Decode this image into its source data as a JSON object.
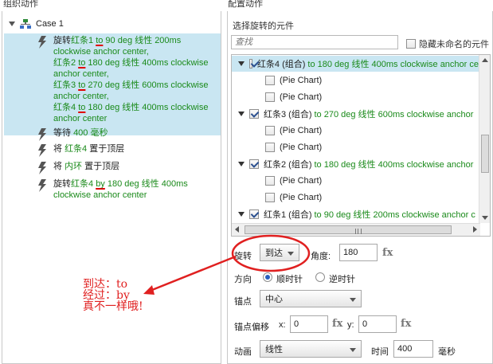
{
  "headers": {
    "left": "组织动作",
    "right": "配置动作"
  },
  "case": {
    "label": "Case 1"
  },
  "actions": [
    {
      "lines": [
        [
          {
            "t": "旋转",
            "c": "k"
          },
          {
            "t": "红条1",
            "c": "g"
          },
          {
            "t": " ",
            "c": "g"
          },
          {
            "t": "to",
            "c": "g",
            "u": true
          },
          {
            "t": " 90 deg 线性 200ms",
            "c": "g"
          }
        ],
        [
          {
            "t": "clockwise anchor center,",
            "c": "g"
          }
        ],
        [
          {
            "t": "红条2 ",
            "c": "g"
          },
          {
            "t": "to",
            "c": "g",
            "u": true
          },
          {
            "t": " 180 deg 线性 400ms clockwise",
            "c": "g"
          }
        ],
        [
          {
            "t": "anchor center,",
            "c": "g"
          }
        ],
        [
          {
            "t": "红条3 ",
            "c": "g"
          },
          {
            "t": "to",
            "c": "g",
            "u": true
          },
          {
            "t": " 270 deg 线性 600ms clockwise",
            "c": "g"
          }
        ],
        [
          {
            "t": "anchor center,",
            "c": "g"
          }
        ],
        [
          {
            "t": "红条4 ",
            "c": "g"
          },
          {
            "t": "to",
            "c": "g",
            "u": true
          },
          {
            "t": " 180 deg 线性 400ms clockwise",
            "c": "g"
          }
        ],
        [
          {
            "t": "anchor center",
            "c": "g"
          }
        ]
      ]
    },
    {
      "lines": [
        [
          {
            "t": "等待 ",
            "c": "k"
          },
          {
            "t": "400 毫秒",
            "c": "g"
          }
        ]
      ]
    },
    {
      "lines": [
        [
          {
            "t": "将 ",
            "c": "k"
          },
          {
            "t": "红条4",
            "c": "g"
          },
          {
            "t": " 置于顶层",
            "c": "k"
          }
        ]
      ]
    },
    {
      "lines": [
        [
          {
            "t": "将 ",
            "c": "k"
          },
          {
            "t": "内环",
            "c": "g"
          },
          {
            "t": " 置于顶层",
            "c": "k"
          }
        ]
      ]
    },
    {
      "lines": [
        [
          {
            "t": "旋转",
            "c": "k"
          },
          {
            "t": "红条4 ",
            "c": "g"
          },
          {
            "t": "by",
            "c": "g",
            "u": true
          },
          {
            "t": " 180 deg 线性 400ms",
            "c": "g"
          }
        ],
        [
          {
            "t": "clockwise anchor center",
            "c": "g"
          }
        ]
      ]
    }
  ],
  "right": {
    "title": "选择旋转的元件",
    "search_placeholder": "查找",
    "hide_unnamed": "隐藏未命名的元件",
    "tree": [
      {
        "type": "group",
        "checked": true,
        "name": "红条4 (组合)",
        "desc": "to 180 deg 线性 400ms clockwise anchor ce",
        "selected": true
      },
      {
        "type": "child",
        "name": "(Pie Chart)"
      },
      {
        "type": "child",
        "name": "(Pie Chart)"
      },
      {
        "type": "group",
        "checked": true,
        "name": "红条3 (组合)",
        "desc": "to 270 deg 线性 600ms clockwise anchor",
        "selected": false
      },
      {
        "type": "child",
        "name": "(Pie Chart)"
      },
      {
        "type": "child",
        "name": "(Pie Chart)"
      },
      {
        "type": "group",
        "checked": true,
        "name": "红条2 (组合)",
        "desc": "to 180 deg 线性 400ms clockwise anchor",
        "selected": false
      },
      {
        "type": "child",
        "name": "(Pie Chart)"
      },
      {
        "type": "child",
        "name": "(Pie Chart)"
      },
      {
        "type": "group",
        "checked": true,
        "name": "红条1 (组合)",
        "desc": "to 90 deg 线性 200ms clockwise anchor c",
        "selected": false
      }
    ],
    "rotate_label": "旋转",
    "rotate_mode": "到达",
    "angle_label": "角度:",
    "angle_value": "180",
    "fx": "fx",
    "direction_label": "方向",
    "clockwise": "顺时针",
    "counterclockwise": "逆时针",
    "anchor_label": "锚点",
    "anchor_value": "中心",
    "offset_label": "锚点偏移",
    "x_label": "x:",
    "x_value": "0",
    "y_label": "y:",
    "y_value": "0",
    "anim_label": "动画",
    "anim_value": "线性",
    "time_label": "时间",
    "time_value": "400",
    "ms_label": "毫秒"
  },
  "annotation": {
    "line1": "到达：to",
    "line2": "经过：by",
    "line3": "真不一样哦!"
  },
  "colors": {
    "selection": "#c9e6f2",
    "green_text": "#1a8a1a",
    "annotation": "#e02020"
  }
}
